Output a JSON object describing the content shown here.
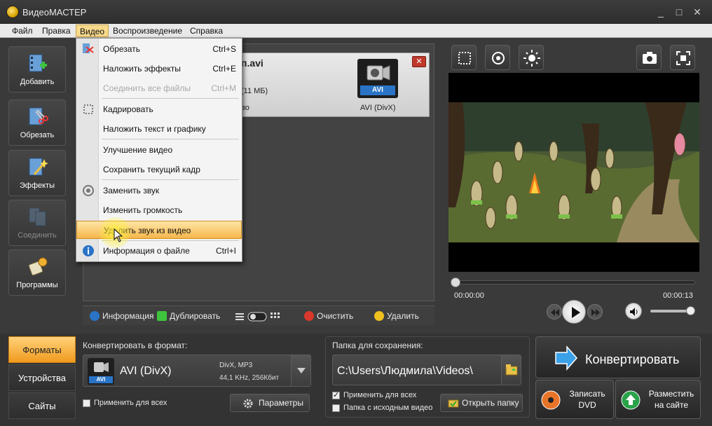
{
  "window": {
    "title": "ВидеоМАСТЕР",
    "controls": {
      "minimize": "_",
      "maximize": "□",
      "close": "✕"
    }
  },
  "menubar": {
    "items": [
      "Файл",
      "Правка",
      "Видео",
      "Воспроизведение",
      "Справка"
    ],
    "active": "Видео"
  },
  "sidebar": {
    "buttons": [
      {
        "label": "Добавить",
        "icon": "film-add-icon",
        "enabled": true
      },
      {
        "label": "Обрезать",
        "icon": "film-scissors-icon",
        "enabled": true
      },
      {
        "label": "Эффекты",
        "icon": "magic-wand-icon",
        "enabled": true
      },
      {
        "label": "Соединить",
        "icon": "film-join-icon",
        "enabled": false
      },
      {
        "label": "Программы",
        "icon": "programs-icon",
        "enabled": true
      }
    ]
  },
  "file_card": {
    "name_fragment": "п.avi",
    "size_fragment": "(11 МБ)",
    "quality_fragment": "во",
    "format_badge": "AVI",
    "format_label": "AVI (DivX)"
  },
  "video_menu": {
    "items": [
      {
        "label": "Обрезать",
        "shortcut": "Ctrl+S",
        "enabled": true,
        "icon": "scissors-icon"
      },
      {
        "label": "Наложить эффекты",
        "shortcut": "Ctrl+E",
        "enabled": true
      },
      {
        "label": "Соединить все файлы",
        "shortcut": "Ctrl+M",
        "enabled": false
      },
      {
        "label": "Кадрировать",
        "shortcut": "",
        "enabled": true,
        "icon": "crop-icon"
      },
      {
        "label": "Наложить текст и графику",
        "shortcut": "",
        "enabled": true
      },
      {
        "label": "Улучшение видео",
        "shortcut": "",
        "enabled": true
      },
      {
        "label": "Сохранить текущий кадр",
        "shortcut": "",
        "enabled": true
      },
      {
        "label": "Заменить звук",
        "shortcut": "",
        "enabled": true,
        "icon": "sound-icon"
      },
      {
        "label": "Изменить громкость",
        "shortcut": "",
        "enabled": true
      },
      {
        "label": "Удалить звук из видео",
        "shortcut": "",
        "enabled": true,
        "highlighted": true
      },
      {
        "label": "Информация о файле",
        "shortcut": "Ctrl+I",
        "enabled": true,
        "icon": "info-icon"
      }
    ]
  },
  "file_toolbar": {
    "info": "Информация",
    "duplicate": "Дублировать",
    "clear": "Очистить",
    "delete": "Удалить"
  },
  "player": {
    "time_current": "00:00:00",
    "time_total": "00:00:13",
    "progress": 0,
    "volume": 1.0
  },
  "bottom_tabs": {
    "items": [
      "Форматы",
      "Устройства",
      "Сайты"
    ],
    "active": "Форматы"
  },
  "convert_format": {
    "label": "Конвертировать в формат:",
    "format_name": "AVI (DivX)",
    "format_badge": "AVI",
    "spec_line1": "DivX, MP3",
    "spec_line2": "44,1 KHz, 256Кбит",
    "apply_all": "Применить для всех",
    "apply_all_checked": false,
    "params_button": "Параметры"
  },
  "save_folder": {
    "label": "Папка для сохранения:",
    "path": "C:\\Users\\Людмила\\Videos\\",
    "apply_all": "Применить для всех",
    "apply_all_checked": true,
    "source_folder": "Папка с исходным видео",
    "source_folder_checked": false,
    "open_button": "Открыть папку"
  },
  "actions": {
    "convert": "Конвертировать",
    "burn_dvd_line1": "Записать",
    "burn_dvd_line2": "DVD",
    "publish_line1": "Разместить",
    "publish_line2": "на сайте"
  },
  "colors": {
    "accent": "#f5a623",
    "menu_highlight": "#f5b64a",
    "badge_blue": "#2a74c7"
  }
}
